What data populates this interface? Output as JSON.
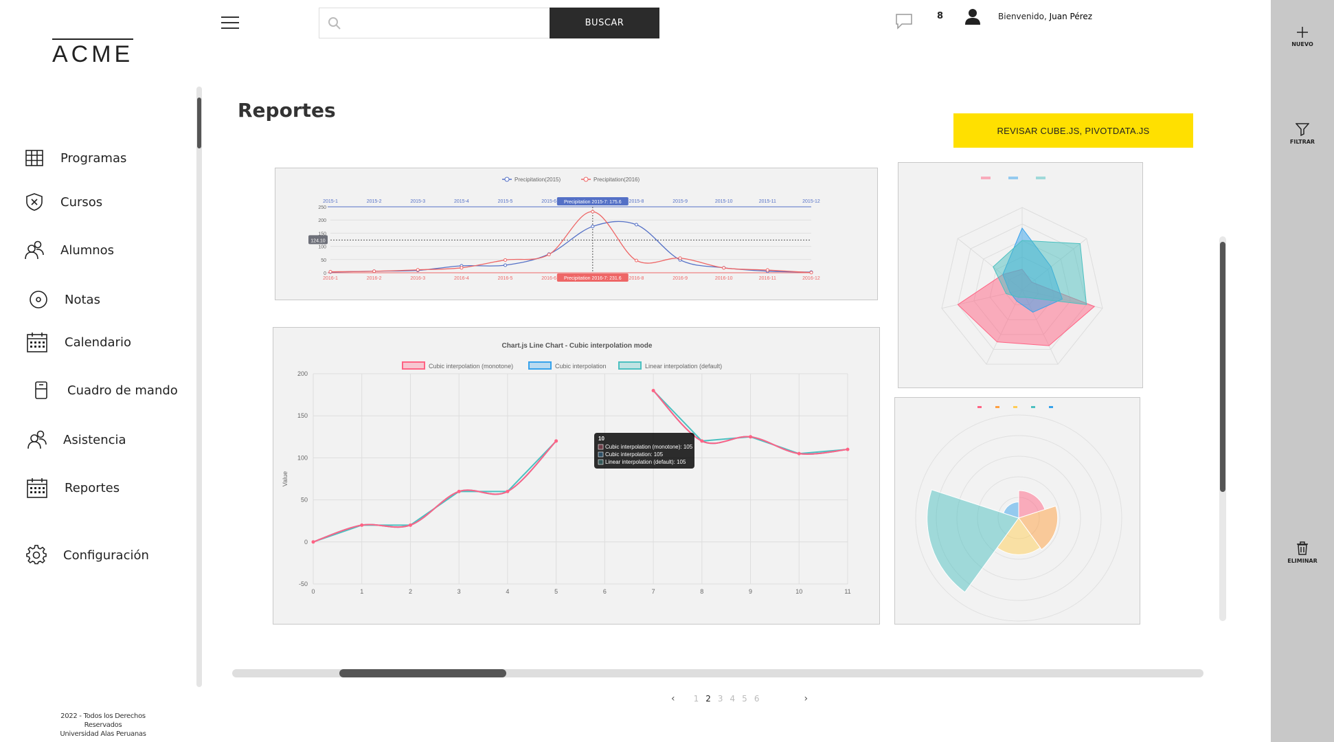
{
  "brand": {
    "logo": "ACME"
  },
  "sidebar": {
    "items": [
      {
        "label": "Programas",
        "icon": "grid-icon"
      },
      {
        "label": "Cursos",
        "icon": "shield-icon"
      },
      {
        "label": "Alumnos",
        "icon": "users-icon"
      },
      {
        "label": "Notas",
        "icon": "disc-icon"
      },
      {
        "label": "Calendario",
        "icon": "calendar-icon"
      },
      {
        "label": "Cuadro de mando",
        "icon": "device-icon"
      },
      {
        "label": "Asistencia",
        "icon": "users-icon"
      },
      {
        "label": "Reportes",
        "icon": "calendar-icon"
      },
      {
        "label": "Configuración",
        "icon": "gear-icon"
      }
    ],
    "footer_line1": "2022 - Todos los Derechos Reservados",
    "footer_line2": "Universidad Alas Peruanas"
  },
  "header": {
    "search_placeholder": "",
    "search_button": "BUSCAR",
    "notifications_count": "8",
    "welcome": "Bienvenido,",
    "user_name": "Juan Pérez"
  },
  "rail": {
    "new": "NUEVO",
    "filter": "FILTRAR",
    "delete": "ELIMINAR"
  },
  "main": {
    "title": "Reportes",
    "review_button": "REVISAR CUBE.JS, PIVOTDATA.JS"
  },
  "pagination": {
    "pages": [
      "1",
      "2",
      "3",
      "4",
      "5",
      "6"
    ],
    "current": "2"
  },
  "colors": {
    "yellow": "#ffe000",
    "red": "#ff6384",
    "blue": "#36a2eb",
    "teal": "#4bc0c0",
    "orange": "#ff9f40"
  },
  "chart_data": [
    {
      "type": "line",
      "legend": [
        "Precipitation(2015)",
        "Precipitation(2016)"
      ],
      "x_top": [
        "2015-1",
        "2015-2",
        "2015-3",
        "2015-4",
        "2015-5",
        "2015-6",
        "2015-7",
        "2015-8",
        "2015-9",
        "2015-10",
        "2015-11",
        "2015-12"
      ],
      "x_bottom": [
        "2016-1",
        "2016-2",
        "2016-3",
        "2016-4",
        "2016-5",
        "2016-6",
        "2016-7",
        "2016-8",
        "2016-9",
        "2016-10",
        "2016-11",
        "2016-12"
      ],
      "yticks": [
        "250",
        "200",
        "150",
        "100",
        "50",
        "0"
      ],
      "ylim": [
        0,
        250
      ],
      "series": [
        {
          "name": "Precipitation(2015)",
          "values": [
            2.6,
            5.9,
            9.0,
            26.4,
            28.7,
            70.7,
            175.6,
            182.2,
            48.7,
            18.8,
            6.0,
            2.3
          ]
        },
        {
          "name": "Precipitation(2016)",
          "values": [
            3.9,
            5.9,
            11.1,
            18.7,
            48.3,
            69.2,
            231.6,
            46.6,
            55.4,
            18.4,
            10.3,
            0.7
          ]
        }
      ],
      "axis_pointer": "124.10",
      "tooltip_top": "Precipitation  2015-7:  175.6",
      "tooltip_bottom": "Precipitation  2016-7:  231.6"
    },
    {
      "type": "line",
      "title": "Chart.js Line Chart - Cubic interpolation mode",
      "ylabel": "Value",
      "categories": [
        "0",
        "1",
        "2",
        "3",
        "4",
        "5",
        "6",
        "7",
        "8",
        "9",
        "10",
        "11"
      ],
      "yticks": [
        "200",
        "150",
        "100",
        "50",
        "0",
        "-50"
      ],
      "ylim": [
        -50,
        200
      ],
      "series": [
        {
          "name": "Cubic interpolation (monotone)",
          "values": [
            0,
            20,
            20,
            60,
            60,
            120,
            null,
            180,
            120,
            125,
            105,
            110
          ]
        },
        {
          "name": "Cubic interpolation",
          "values": [
            0,
            20,
            20,
            60,
            60,
            120,
            null,
            180,
            120,
            125,
            105,
            110
          ]
        },
        {
          "name": "Linear interpolation (default)",
          "values": [
            0,
            20,
            20,
            60,
            60,
            120,
            null,
            180,
            120,
            125,
            105,
            110
          ]
        }
      ],
      "tooltip": {
        "title": "10",
        "lines": [
          "Cubic interpolation (monotone): 105",
          "Cubic interpolation: 105",
          "Linear interpolation (default): 105"
        ]
      }
    },
    {
      "type": "radar",
      "axes": 7,
      "series": [
        {
          "values": [
            25,
            15,
            90,
            75,
            70,
            80,
            30
          ]
        },
        {
          "values": [
            75,
            45,
            50,
            30,
            15,
            15,
            30
          ]
        },
        {
          "values": [
            60,
            90,
            80,
            10,
            10,
            20,
            45
          ]
        }
      ],
      "max": 100
    },
    {
      "type": "polarArea",
      "values": [
        12,
        17,
        16,
        40,
        7
      ],
      "max": 45
    }
  ]
}
